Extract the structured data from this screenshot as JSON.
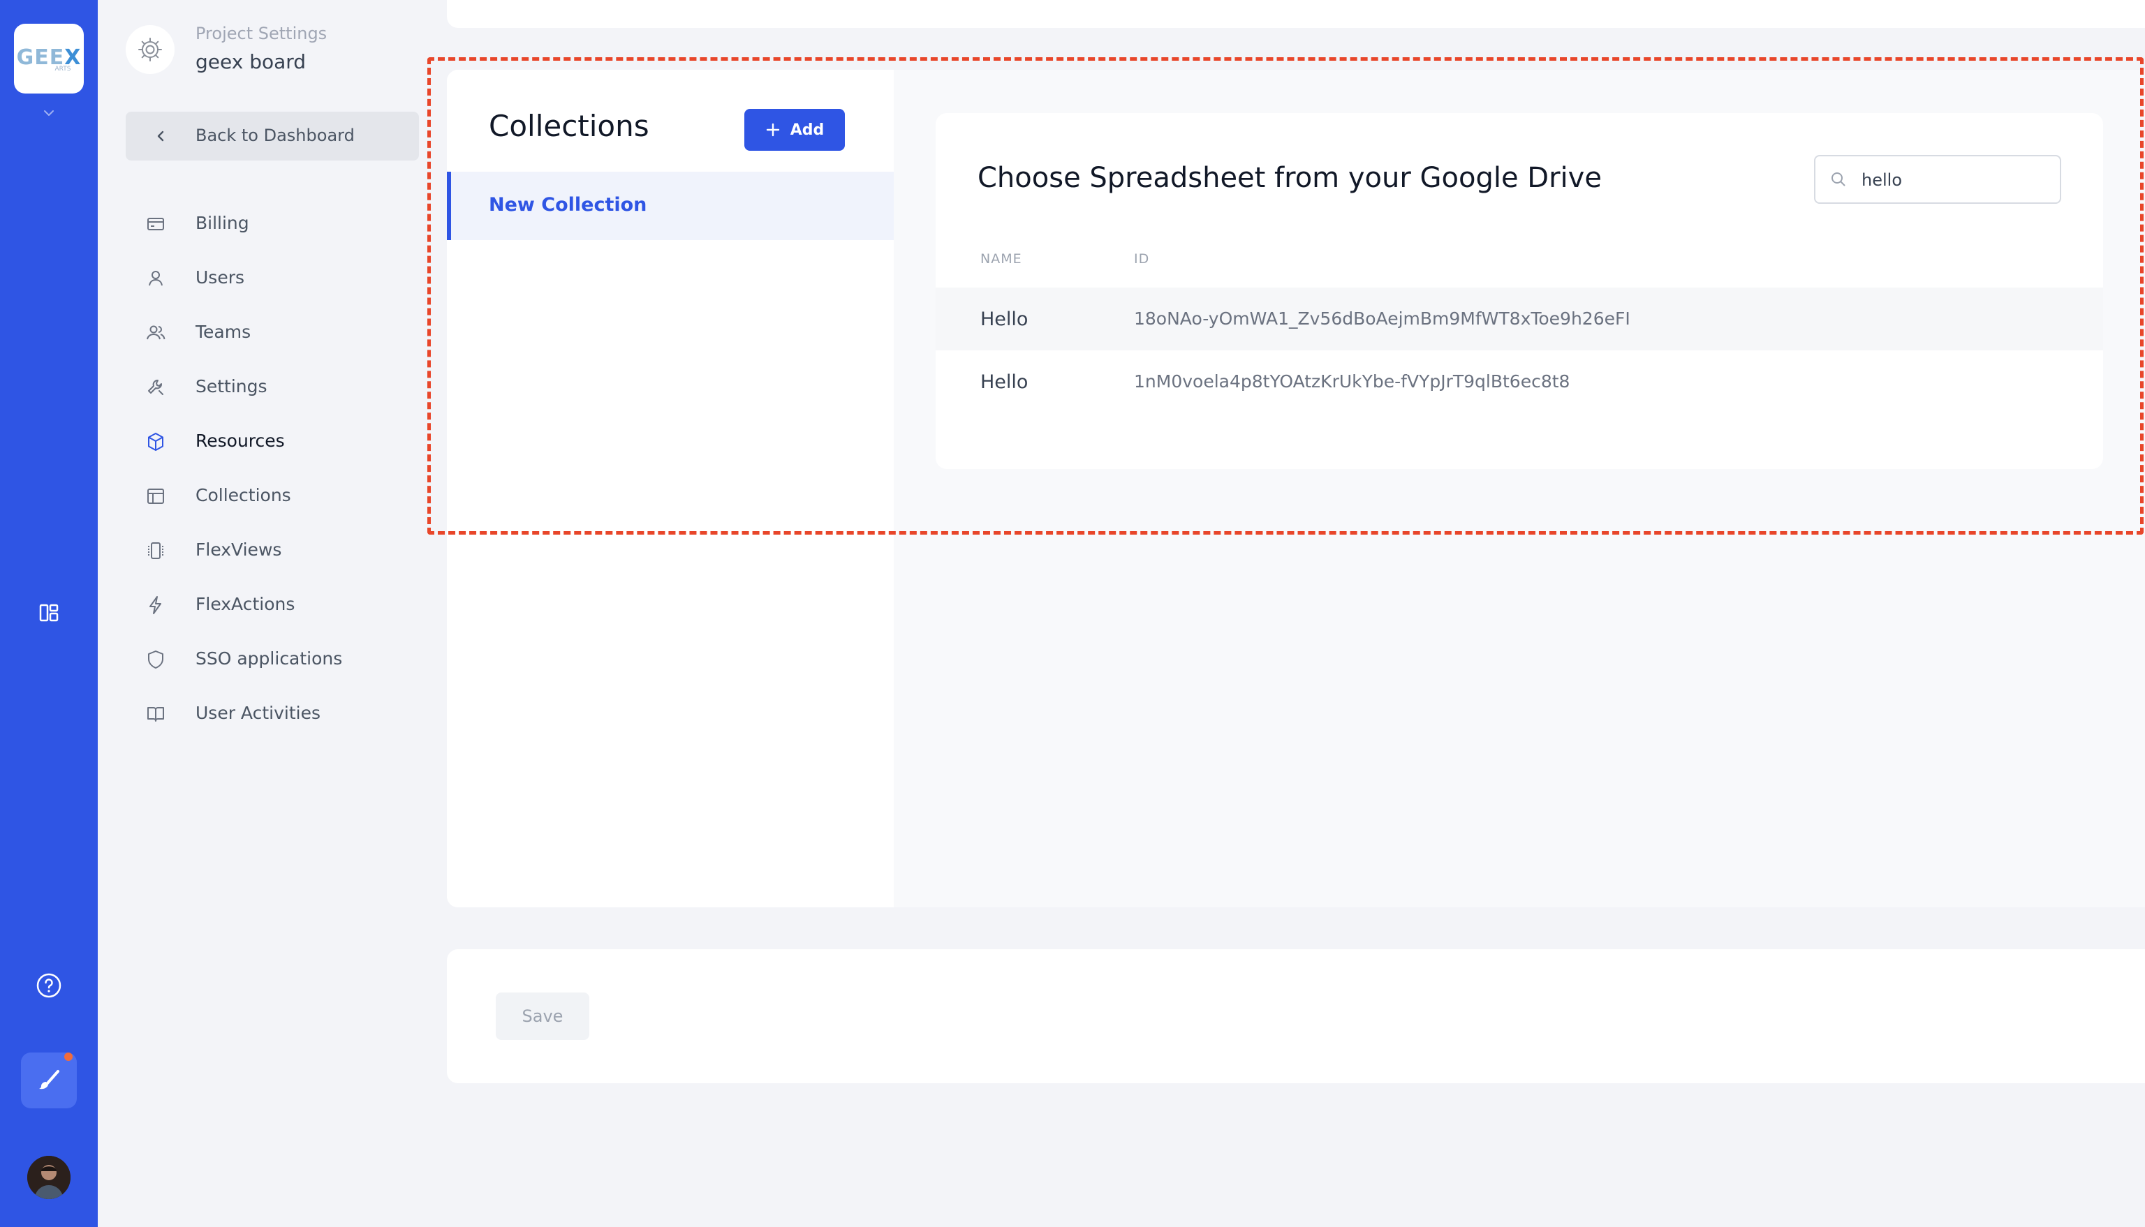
{
  "rail": {
    "logo_main": "GEE",
    "logo_x": "X",
    "logo_sub": "ARTS"
  },
  "settings": {
    "subtitle": "Project Settings",
    "title": "geex board"
  },
  "back_label": "Back to Dashboard",
  "nav": {
    "items": [
      {
        "label": "Billing",
        "icon": "credit-card-icon"
      },
      {
        "label": "Users",
        "icon": "user-icon"
      },
      {
        "label": "Teams",
        "icon": "users-icon"
      },
      {
        "label": "Settings",
        "icon": "wrench-icon"
      },
      {
        "label": "Resources",
        "icon": "cube-icon",
        "active": true
      },
      {
        "label": "Collections",
        "icon": "table-icon"
      },
      {
        "label": "FlexViews",
        "icon": "views-icon"
      },
      {
        "label": "FlexActions",
        "icon": "lightning-icon"
      },
      {
        "label": "SSO applications",
        "icon": "shield-icon"
      },
      {
        "label": "User Activities",
        "icon": "book-icon"
      }
    ]
  },
  "collections": {
    "title": "Collections",
    "add_label": "Add",
    "items": [
      {
        "label": "New Collection",
        "selected": true
      }
    ]
  },
  "picker": {
    "title": "Choose Spreadsheet from your Google Drive",
    "search_value": "hello",
    "columns": [
      "NAME",
      "ID"
    ],
    "rows": [
      {
        "name": "Hello",
        "id": "18oNAo-yOmWA1_Zv56dBoAejmBm9MfWT8xToe9h26eFI"
      },
      {
        "name": "Hello",
        "id": "1nM0voela4p8tYOAtzKrUkYbe-fVYpJrT9qlBt6ec8t8"
      }
    ]
  },
  "save_label": "Save",
  "colors": {
    "primary": "#2f55e4",
    "highlight": "#e8462a",
    "notification_dot": "#f26b3a"
  }
}
